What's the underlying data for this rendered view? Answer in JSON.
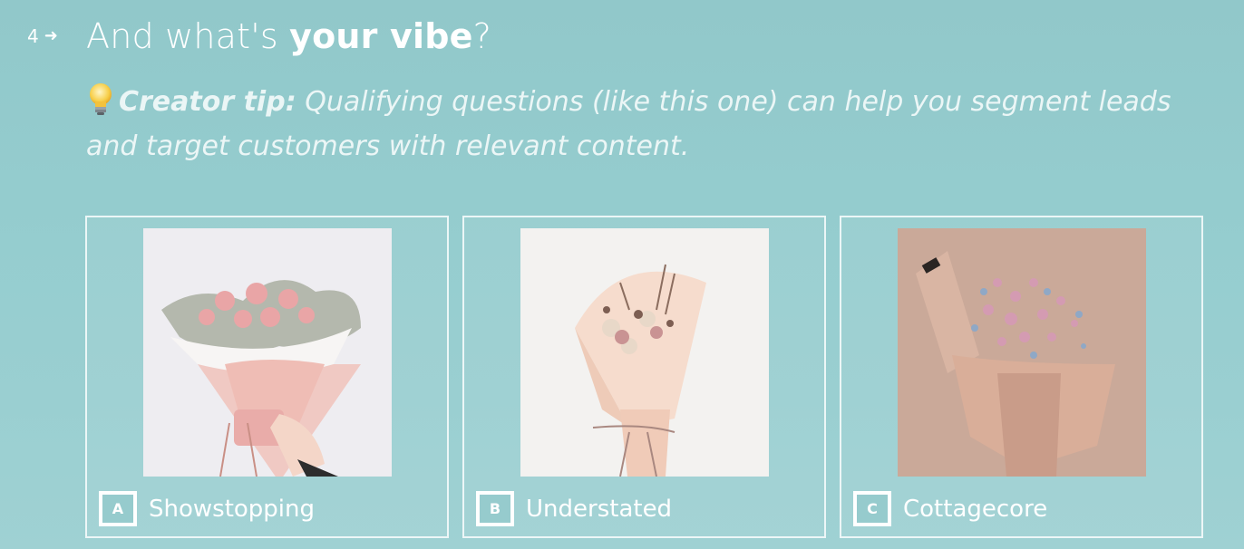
{
  "question": {
    "number": "4",
    "arrow_icon": "arrow-right-icon",
    "title_prefix": "And what's ",
    "title_bold": "your vibe",
    "title_suffix": "?"
  },
  "tip": {
    "icon": "lightbulb-icon",
    "label": "Creator tip:",
    "text": " Qualifying questions (like this one) can help you segment leads and target customers with relevant content."
  },
  "choices": [
    {
      "key": "A",
      "label": "Showstopping",
      "image": "pink-bouquet-held-in-hand"
    },
    {
      "key": "B",
      "label": "Understated",
      "image": "small-dried-flower-cone-bouquet"
    },
    {
      "key": "C",
      "label": "Cottagecore",
      "image": "babys-breath-bouquet-on-beige"
    }
  ],
  "colors": {
    "background": "#95cdcf",
    "text": "#ffffff",
    "border": "#ffffff"
  }
}
